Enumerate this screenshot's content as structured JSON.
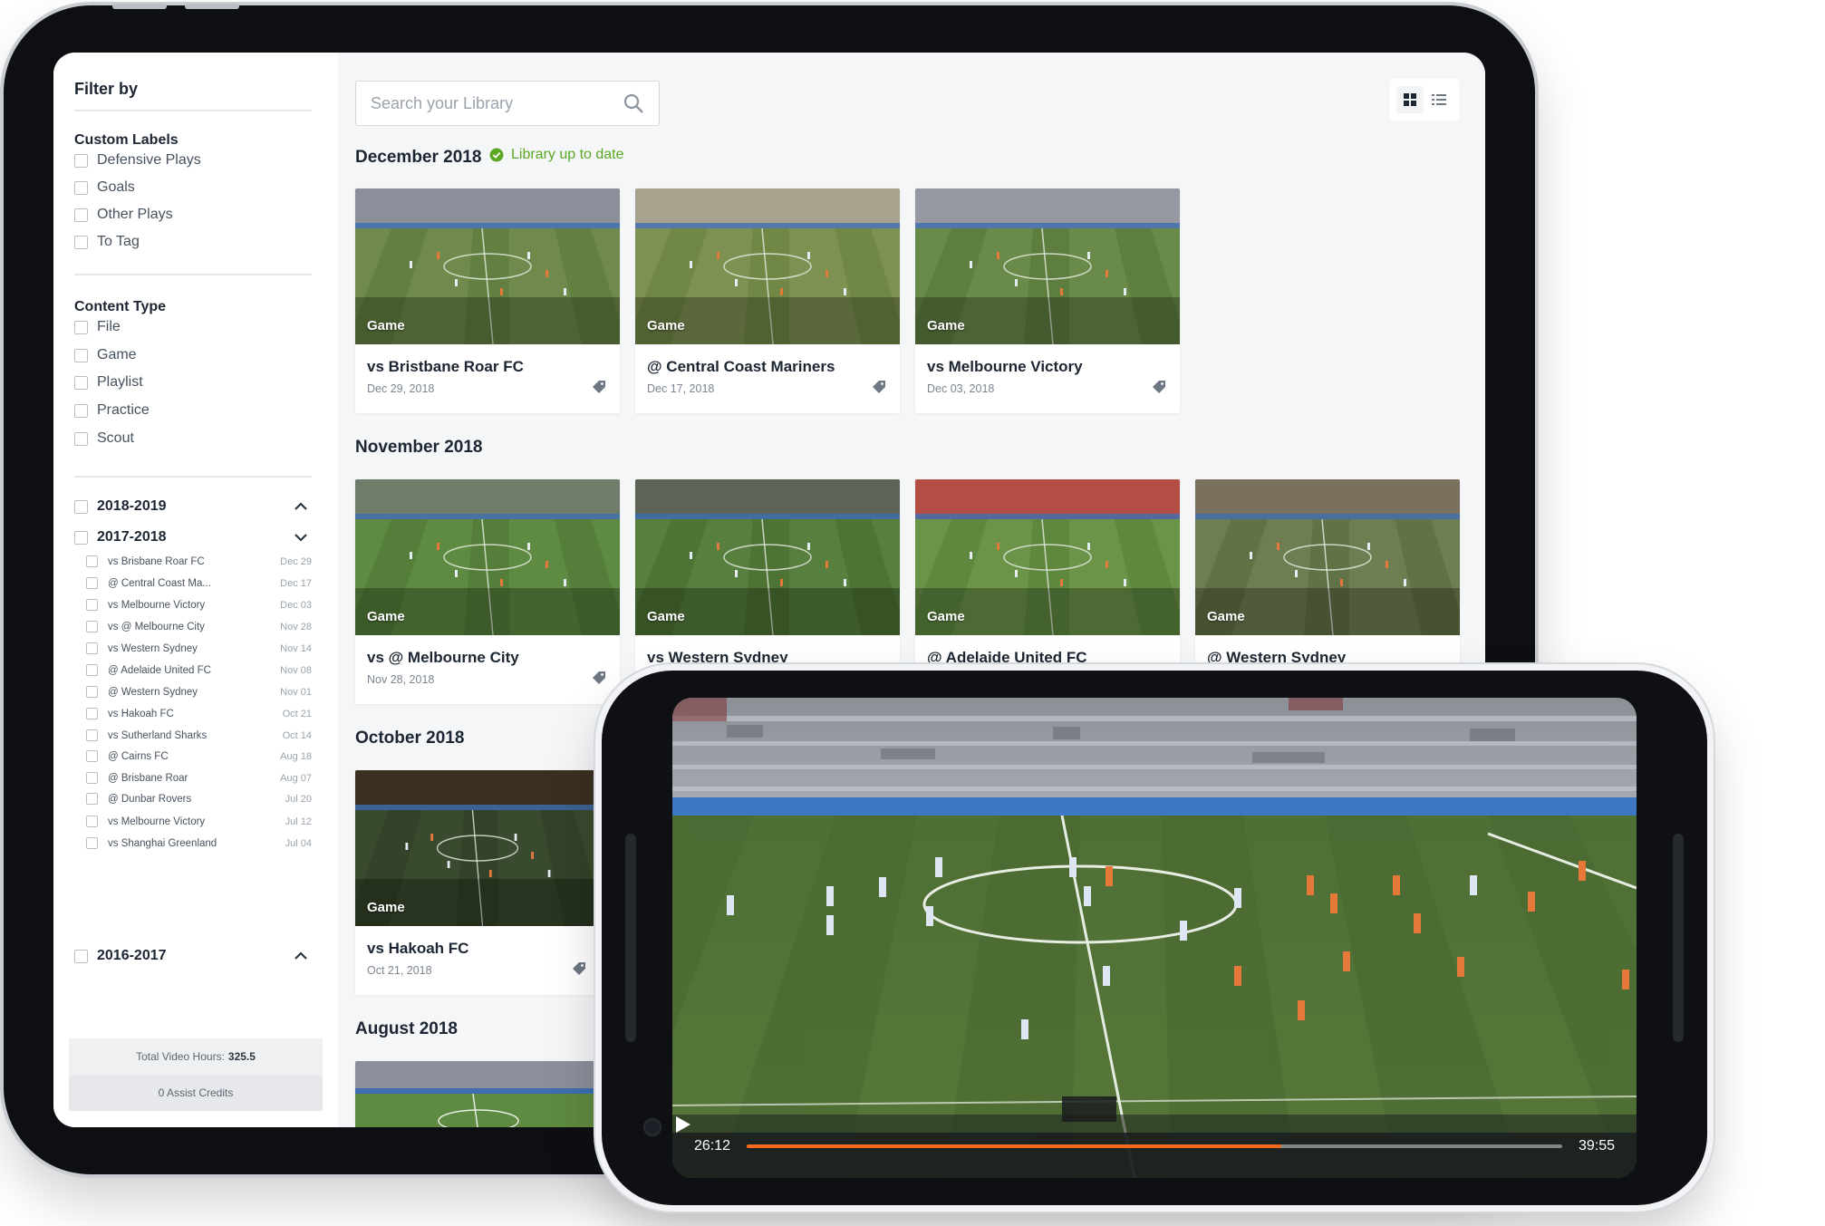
{
  "sidebar": {
    "filter_title": "Filter by",
    "custom_labels_title": "Custom Labels",
    "custom_labels": [
      "Defensive Plays",
      "Goals",
      "Other Plays",
      "To Tag"
    ],
    "content_type_title": "Content Type",
    "content_types": [
      "File",
      "Game",
      "Playlist",
      "Practice",
      "Scout"
    ],
    "seasons": [
      {
        "label": "2018-2019",
        "state": "collapsed"
      },
      {
        "label": "2017-2018",
        "state": "expanded"
      },
      {
        "label": "2016-2017",
        "state": "collapsed"
      }
    ],
    "season_2017_games": [
      {
        "name": "vs Brisbane Roar FC",
        "date": "Dec 29"
      },
      {
        "name": "@ Central Coast Ma...",
        "date": "Dec 17"
      },
      {
        "name": "vs Melbourne Victory",
        "date": "Dec 03"
      },
      {
        "name": "vs @ Melbourne City",
        "date": "Nov 28"
      },
      {
        "name": "vs Western Sydney",
        "date": "Nov 14"
      },
      {
        "name": "@ Adelaide United FC",
        "date": "Nov 08"
      },
      {
        "name": "@ Western Sydney",
        "date": "Nov 01"
      },
      {
        "name": "vs Hakoah FC",
        "date": "Oct 21"
      },
      {
        "name": "vs Sutherland Sharks",
        "date": "Oct 14"
      },
      {
        "name": "@ Cairns FC",
        "date": "Aug 18"
      },
      {
        "name": "@ Brisbane Roar",
        "date": "Aug 07"
      },
      {
        "name": "@ Dunbar Rovers",
        "date": "Jul 20"
      },
      {
        "name": "vs Melbourne Victory",
        "date": "Jul 12"
      },
      {
        "name": "vs Shanghai Greenland",
        "date": "Jul 04"
      }
    ],
    "total_hours_label": "Total Video Hours:",
    "total_hours_value": "325.5",
    "assist_credits": "0 Assist Credits"
  },
  "main": {
    "search_placeholder": "Search your Library",
    "library_status": "Library up to date",
    "sections": [
      {
        "month": "December 2018",
        "cards": [
          {
            "tag": "Game",
            "title": "vs Bristbane Roar FC",
            "date": "Dec 29, 2018"
          },
          {
            "tag": "Game",
            "title": "@ Central Coast Mariners",
            "date": "Dec 17, 2018"
          },
          {
            "tag": "Game",
            "title": "vs Melbourne Victory",
            "date": "Dec 03, 2018"
          }
        ]
      },
      {
        "month": "November 2018",
        "cards": [
          {
            "tag": "Game",
            "title": "vs @ Melbourne City",
            "date": "Nov 28, 2018"
          },
          {
            "tag": "Game",
            "title": "vs Western Sydney",
            "date": ""
          },
          {
            "tag": "Game",
            "title": "@ Adelaide United FC",
            "date": ""
          },
          {
            "tag": "Game",
            "title": "@ Western Sydney",
            "date": ""
          }
        ]
      },
      {
        "month": "October 2018",
        "cards": [
          {
            "tag": "Game",
            "title": "vs Hakoah FC",
            "date": "Oct 21, 2018"
          }
        ]
      },
      {
        "month": "August 2018",
        "cards": []
      }
    ]
  },
  "player": {
    "current_time": "26:12",
    "duration": "39:55",
    "progress_fraction": 0.6557,
    "accent_color": "#f26a1b"
  },
  "colors": {
    "status_green": "#5aa823",
    "pitch_green": "#4f7a33"
  }
}
